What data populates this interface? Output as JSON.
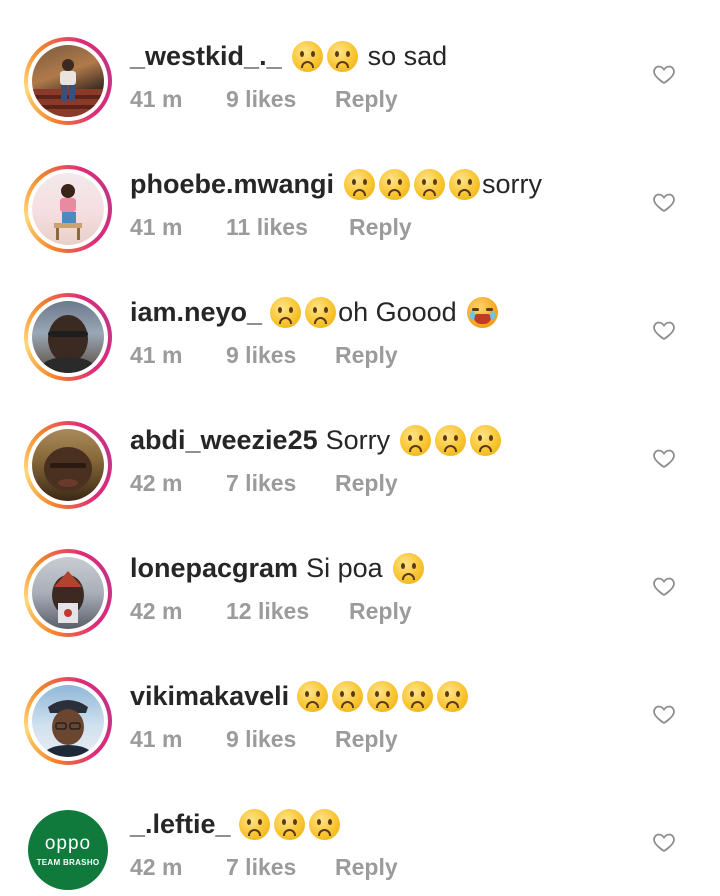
{
  "colors": {
    "username": "#262626",
    "meta": "#9b9b9b",
    "ring_start": "#f58529",
    "ring_end": "#c13584",
    "oppo_green": "#0f7a3c"
  },
  "comments": [
    {
      "username": "_westkid_._",
      "text": "so sad",
      "emojis": [
        "sad-face",
        "sad-face"
      ],
      "text_after": true,
      "time": "41 m",
      "likes": "9 likes",
      "reply": "Reply",
      "avatar": "photo"
    },
    {
      "username": "phoebe.mwangi",
      "text": "sorry",
      "emojis": [
        "sad-face",
        "sad-face",
        "sad-face",
        "sad-face"
      ],
      "text_after": true,
      "time": "41 m",
      "likes": "11 likes",
      "reply": "Reply",
      "avatar": "photo"
    },
    {
      "username": "iam.neyo_",
      "text": "oh Goood",
      "emojis": [
        "sad-face",
        "sad-face"
      ],
      "text_after": true,
      "trailing_emoji": "crying-face",
      "time": "41 m",
      "likes": "9 likes",
      "reply": "Reply",
      "avatar": "photo"
    },
    {
      "username": "abdi_weezie25",
      "text": "Sorry",
      "emojis": [
        "sad-face",
        "sad-face",
        "sad-face"
      ],
      "text_after": false,
      "time": "42 m",
      "likes": "7 likes",
      "reply": "Reply",
      "avatar": "photo"
    },
    {
      "username": "lonepacgram",
      "text": "Si poa",
      "emojis": [
        "sad-face"
      ],
      "text_after": false,
      "time": "42 m",
      "likes": "12 likes",
      "reply": "Reply",
      "avatar": "photo"
    },
    {
      "username": "vikimakaveli",
      "text": "",
      "emojis": [
        "sad-face",
        "sad-face",
        "sad-face",
        "sad-face",
        "sad-face"
      ],
      "text_after": false,
      "time": "41 m",
      "likes": "9 likes",
      "reply": "Reply",
      "avatar": "photo"
    },
    {
      "username": "_.leftie_",
      "text": "",
      "emojis": [
        "sad-face",
        "sad-face",
        "sad-face"
      ],
      "text_after": false,
      "time": "42 m",
      "likes": "7 likes",
      "reply": "Reply",
      "avatar": "oppo"
    }
  ],
  "oppo_avatar": {
    "logo": "oppo",
    "sub": "TEAM BRASHO"
  },
  "icons": {
    "like": "heart-outline-icon",
    "sad": "sad-face-emoji",
    "cry": "crying-face-emoji"
  }
}
